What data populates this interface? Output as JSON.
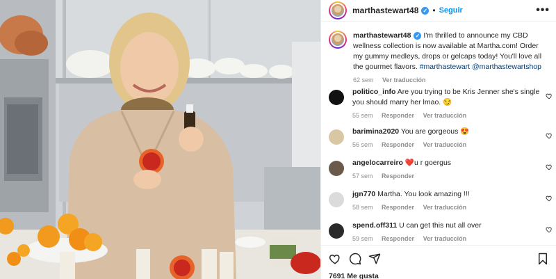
{
  "post": {
    "author": "marthastewart48",
    "follow_label": "Seguir",
    "more_label": "•••",
    "likes_text": "7691 Me gusta"
  },
  "caption": {
    "username": "marthastewart48",
    "text": " I'm thrilled to announce my CBD wellness collection is now available at Martha.com! Order my gummy medleys, drops or gelcaps today! You'll love all the gourmet flavors. ",
    "hashtag": "#marthastewart",
    "mention": "@marthastewartshop",
    "time": "62 sem",
    "translate_label": "Ver traducción"
  },
  "comments": [
    {
      "username": "politico_info",
      "text": " Are you trying to be Kris Jenner she's single you should marry her lmao. 😏",
      "time": "55 sem",
      "reply_label": "Responder",
      "translate_label": "Ver traducción",
      "avatar_color": "#111111"
    },
    {
      "username": "barimina2020",
      "text": " You are gorgeous 😍",
      "time": "56 sem",
      "reply_label": "Responder",
      "translate_label": "Ver traducción",
      "avatar_color": "#d9c7a3"
    },
    {
      "username": "angelocarreiro",
      "text": " ❤️u r goergus",
      "time": "57 sem",
      "reply_label": "Responder",
      "translate_label": "",
      "avatar_color": "#6b5a4a"
    },
    {
      "username": "jgn770",
      "text": " Martha. You look amazing !!!",
      "time": "58 sem",
      "reply_label": "Responder",
      "translate_label": "Ver traducción",
      "avatar_color": "#dbdbdb"
    },
    {
      "username": "spend.off311",
      "text": " U can get this nut all over",
      "time": "59 sem",
      "reply_label": "Responder",
      "translate_label": "Ver traducción",
      "avatar_color": "#2a2a2a"
    }
  ],
  "colors": {
    "link": "#00376b",
    "follow": "#0095f6",
    "verified": "#3897f0",
    "meta": "#8e8e8e"
  }
}
